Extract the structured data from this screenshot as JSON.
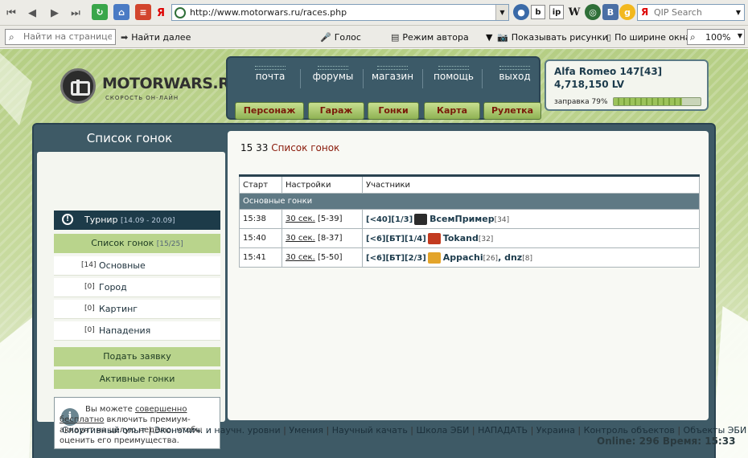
{
  "browser": {
    "url": "http://www.motorwars.ru/races.php",
    "search_placeholder": "QIP Search",
    "find_placeholder": "Найти на странице",
    "find_next": "Найти далее",
    "voice": "Голос",
    "author_mode": "Режим автора",
    "show_images": "Показывать рисунки",
    "fit_width": "По ширине окна",
    "zoom": "100%"
  },
  "logo": {
    "title": "MOTORWARS.RU",
    "subtitle": "СКОРОСТЬ ОН-ЛАЙН"
  },
  "nav": {
    "top": [
      "почта",
      "форумы",
      "магазин",
      "помощь",
      "выход"
    ],
    "buttons": [
      "Персонаж",
      "Гараж",
      "Гонки",
      "Карта",
      "Рулетка"
    ]
  },
  "car": {
    "name": "Alfa Romeo 147[43]",
    "lv": "4,718,150 LV",
    "fuel_label": "заправка 79%",
    "fuel_value": 79
  },
  "sidebar": {
    "title": "Список гонок",
    "tournament": {
      "label": "Турнир",
      "dates": "[14.09 - 20.09]"
    },
    "race_list": {
      "label": "Список гонок",
      "count": "[15/25]"
    },
    "categories": [
      {
        "count": "[14]",
        "label": "Основные"
      },
      {
        "count": "[0]",
        "label": "Город"
      },
      {
        "count": "[0]",
        "label": "Картинг"
      },
      {
        "count": "[0]",
        "label": "Нападения"
      }
    ],
    "apply": "Подать заявку",
    "active": "Активные гонки",
    "promo": {
      "pre": "Вы можете",
      "link": "совершенно бесплатно",
      "post": "включить премиум-аккаунт на целую неделю, чтобы оценить его преимущества."
    }
  },
  "content": {
    "time": "15 33",
    "title": "Список гонок",
    "headers": [
      "Старт",
      "Настройки",
      "Участники"
    ],
    "group": "Основные гонки",
    "rows": [
      {
        "start": "15:38",
        "settings_link": "30 сек.",
        "settings_range": "[5-39]",
        "tags": "[<40][1/3]",
        "player": "ВсемПример",
        "level": "[34]",
        "player2": "",
        "level2": ""
      },
      {
        "start": "15:40",
        "settings_link": "30 сек.",
        "settings_range": "[8-37]",
        "tags": "[<6][БТ][1/4]",
        "player": "Tokand",
        "level": "[32]",
        "player2": "",
        "level2": ""
      },
      {
        "start": "15:41",
        "settings_link": "30 сек.",
        "settings_range": "[5-50]",
        "tags": "[<6][БТ][2/3]",
        "player": "Appachi",
        "level": "[26]",
        "player2": "dnz",
        "level2": "[8]"
      }
    ]
  },
  "footer": {
    "links": [
      "Спортивный опыт",
      "Экономич. и научн. уровни",
      "Умения",
      "Научный качать",
      "Школа ЭБИ",
      "НАПАДАТЬ",
      "Украина",
      "Контроль объектов",
      "Объекты ЭБИ"
    ],
    "online": "Online: 296  Время: 15:33"
  },
  "colors": {
    "frame": "#3e5a66",
    "accent_red": "#8a1a0a",
    "green_button": "#b9d48c",
    "dark_tab": "#1d3b49"
  }
}
